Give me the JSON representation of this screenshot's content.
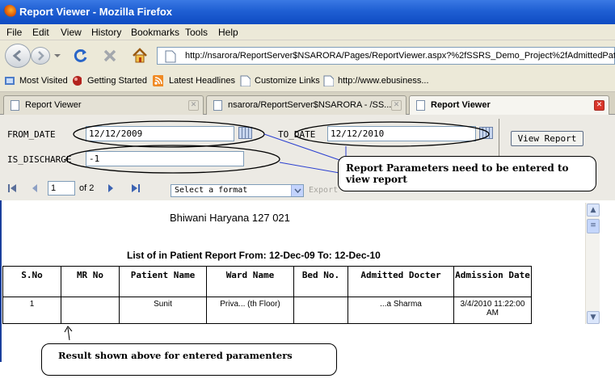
{
  "window": {
    "title": "Report Viewer - Mozilla Firefox"
  },
  "menu": [
    "File",
    "Edit",
    "View",
    "History",
    "Bookmarks",
    "Tools",
    "Help"
  ],
  "address": {
    "url": "http://nsarora/ReportServer$NSARORA/Pages/ReportViewer.aspx?%2fSSRS_Demo_Project%2fAdmittedPat"
  },
  "bookmarks": [
    "Most Visited",
    "Getting Started",
    "Latest Headlines",
    "Customize Links",
    "http://www.ebusiness..."
  ],
  "tabs": [
    {
      "label": "Report Viewer",
      "active": false
    },
    {
      "label": "nsarora/ReportServer$NSARORA - /SS...",
      "active": false
    },
    {
      "label": "Report Viewer",
      "active": true
    }
  ],
  "params": {
    "from_label": "FROM_DATE",
    "from_value": "12/12/2009",
    "to_label": "TO_DATE",
    "to_value": "12/12/2010",
    "discharge_label": "IS_DISCHARGE",
    "discharge_value": "-1",
    "view_report": "View Report"
  },
  "toolbar": {
    "page": "1",
    "of": "of 2",
    "format": "Select a format",
    "export": "Export"
  },
  "report": {
    "address_line": "Bhiwani Haryana 127 021",
    "title": "List of in Patient Report From: 12-Dec-09 To: 12-Dec-10",
    "headers": [
      "S.No",
      "MR No",
      "Patient Name",
      "Ward Name",
      "Bed No.",
      "Admitted Docter",
      "Admission Date"
    ],
    "rows": [
      [
        "1",
        "",
        "Sunit",
        "Priva... (th Floor)",
        "",
        "...a Sharma",
        "3/4/2010 11:22:00 AM"
      ]
    ]
  },
  "annotations": {
    "params_note": "Report Parameters need to be entered to view report",
    "result_note": "Result shown above for entered paramenters"
  },
  "colors": {
    "titlebar": "#1f5fd3",
    "chrome": "#ece9d8",
    "params_bg": "#eceae4",
    "annotation_line": "#2a3fd0"
  }
}
